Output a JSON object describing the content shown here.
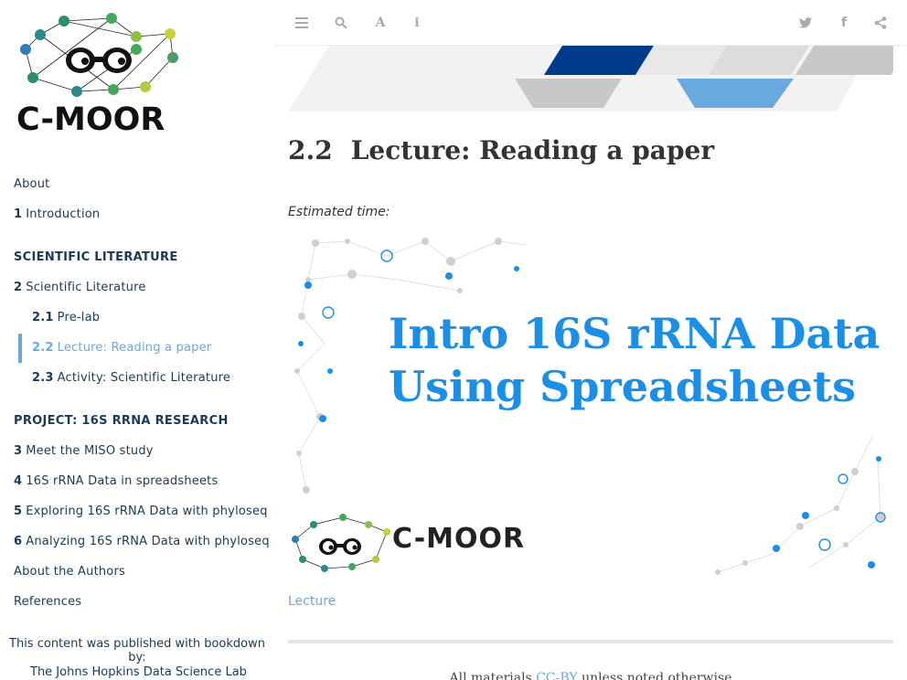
{
  "sidebar": {
    "logo_text": "C-MOOR",
    "items": [
      {
        "num": "",
        "label": "About"
      },
      {
        "num": "1",
        "label": "Introduction"
      }
    ],
    "section_scientific": "SCIENTIFIC LITERATURE",
    "scientific_items": [
      {
        "num": "2",
        "label": "Scientific Literature"
      },
      {
        "num": "2.1",
        "label": "Pre-lab"
      },
      {
        "num": "2.2",
        "label": "Lecture: Reading a paper"
      },
      {
        "num": "2.3",
        "label": "Activity: Scientific Literature"
      }
    ],
    "section_project": "PROJECT: 16S RRNA RESEARCH",
    "project_items": [
      {
        "num": "3",
        "label": "Meet the MISO study"
      },
      {
        "num": "4",
        "label": "16S rRNA Data in spreadsheets"
      },
      {
        "num": "5",
        "label": "Exploring 16S rRNA Data with phyloseq"
      },
      {
        "num": "6",
        "label": "Analyzing 16S rRNA Data with phyloseq"
      }
    ],
    "about_authors": "About the Authors",
    "references": "References",
    "published": "This content was published with bookdown by:",
    "lab": "The Johns Hopkins Data Science Lab"
  },
  "toolbar": {
    "icons": [
      "menu-icon",
      "search-icon",
      "font-icon",
      "info-icon",
      "twitter-icon",
      "facebook-icon",
      "share-icon"
    ]
  },
  "main": {
    "section_number": "2.2",
    "title": "Lecture: Reading a paper",
    "estimated_time": "Estimated time:",
    "slide": {
      "title_line1": "Intro 16S rRNA Data",
      "title_line2": "Using Spreadsheets",
      "brand": "C-MOOR"
    },
    "lecture_link": "Lecture",
    "footer_prefix": "All materials",
    "footer_link": "CC-BY",
    "footer_suffix": "unless noted otherwise"
  },
  "colors": {
    "accent": "#6aa9e0",
    "nav_text": "#1b3a57",
    "slide_title": "#1b8fe6"
  }
}
